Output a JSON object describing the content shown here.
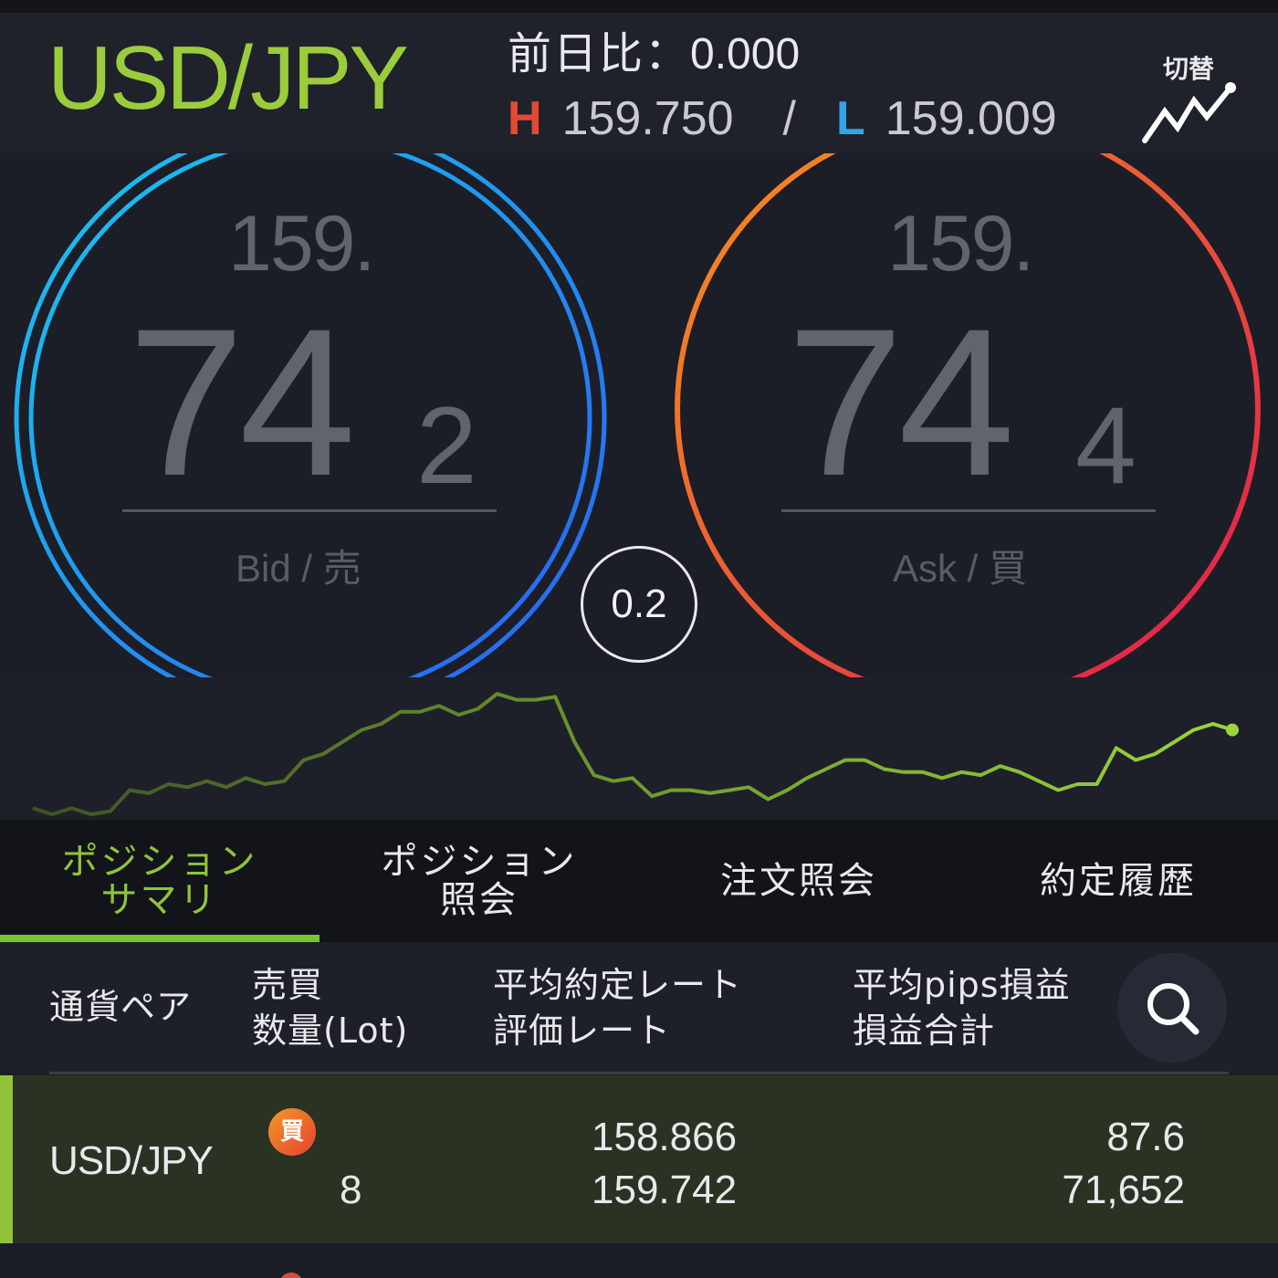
{
  "header": {
    "pair": "USD/JPY",
    "change_label": "前日比：",
    "change_value": "0.000",
    "high_label": "H",
    "high_value": "159.750",
    "separator": "/",
    "low_label": "L",
    "low_value": "159.009",
    "switch_label": "切替",
    "switch_icon": "line-chart-icon"
  },
  "bid": {
    "prefix": "159.",
    "main": "74",
    "pip": "2",
    "label": "Bid / 売",
    "ring_colors": [
      "#18c8f0",
      "#2a5ff0"
    ]
  },
  "ask": {
    "prefix": "159.",
    "main": "74",
    "pip": "4",
    "label": "Ask / 買",
    "ring_colors": [
      "#f7931e",
      "#e0174f"
    ]
  },
  "spread": "0.2",
  "tabs": [
    {
      "label_line1": "ポジション",
      "label_line2": "サマリ",
      "active": true
    },
    {
      "label_line1": "ポジション",
      "label_line2": "照会",
      "active": false
    },
    {
      "label_line1": "注文照会",
      "label_line2": "",
      "active": false
    },
    {
      "label_line1": "約定履歴",
      "label_line2": "",
      "active": false
    }
  ],
  "columns": {
    "pair": "通貨ペア",
    "side_line1": "売買",
    "side_line2": "数量(Lot)",
    "rate_line1": "平均約定レート",
    "rate_line2": "評価レート",
    "pl_line1": "平均pips損益",
    "pl_line2": "損益合計",
    "search_icon": "search-icon"
  },
  "positions": [
    {
      "pair": "USD/JPY",
      "side": "買",
      "lots": "8",
      "avg_rate": "158.866",
      "eval_rate": "159.742",
      "avg_pips": "87.6",
      "total_pl": "71,652"
    }
  ],
  "colors": {
    "accent_green": "#8fc43a",
    "high_red": "#e24a32",
    "low_blue": "#33a4e8"
  },
  "sparkline": {
    "values": [
      159.04,
      159.02,
      159.04,
      159.02,
      159.03,
      159.1,
      159.09,
      159.12,
      159.11,
      159.13,
      159.11,
      159.14,
      159.12,
      159.13,
      159.2,
      159.22,
      159.26,
      159.3,
      159.32,
      159.36,
      159.36,
      159.38,
      159.35,
      159.37,
      159.42,
      159.4,
      159.4,
      159.41,
      159.26,
      159.15,
      159.13,
      159.14,
      159.08,
      159.1,
      159.1,
      159.09,
      159.1,
      159.11,
      159.07,
      159.1,
      159.14,
      159.17,
      159.2,
      159.2,
      159.17,
      159.16,
      159.16,
      159.14,
      159.16,
      159.15,
      159.18,
      159.16,
      159.13,
      159.1,
      159.12,
      159.12,
      159.24,
      159.2,
      159.22,
      159.26,
      159.3,
      159.32,
      159.3
    ]
  }
}
